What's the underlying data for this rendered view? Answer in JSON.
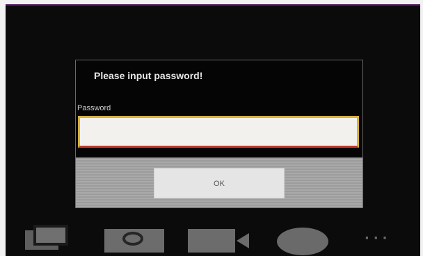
{
  "dialog": {
    "title": "Please input password!",
    "password_label": "Password",
    "password_value": "",
    "ok_label": "OK"
  },
  "bottom_bar": {
    "icons": [
      "gallery-icon",
      "camera-icon",
      "video-camera-icon",
      "record-icon",
      "more-icon"
    ],
    "more_label": "···"
  }
}
